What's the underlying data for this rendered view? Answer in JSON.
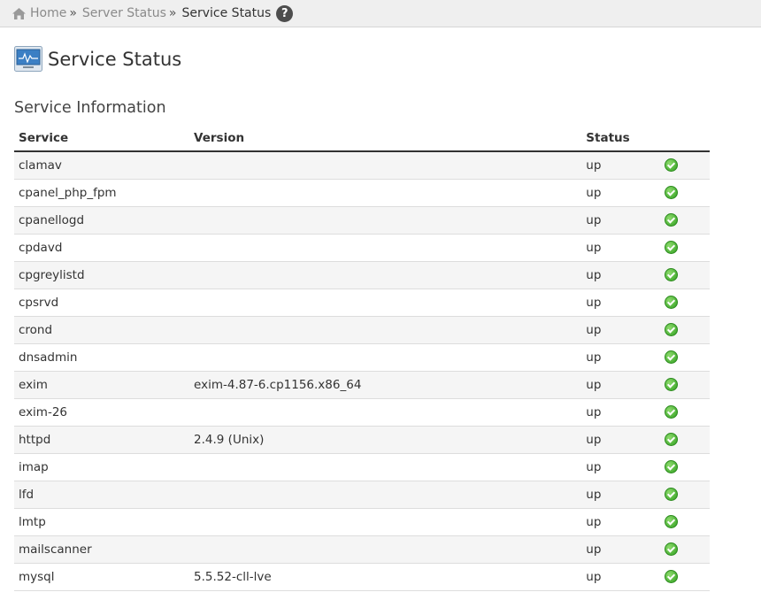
{
  "breadcrumb": {
    "home": "Home",
    "parent": "Server Status",
    "current": "Service Status",
    "separator": "»"
  },
  "page": {
    "title": "Service Status",
    "section_title": "Service Information"
  },
  "table": {
    "headers": {
      "service": "Service",
      "version": "Version",
      "status": "Status"
    },
    "rows": [
      {
        "service": "clamav",
        "version": "",
        "status": "up"
      },
      {
        "service": "cpanel_php_fpm",
        "version": "",
        "status": "up"
      },
      {
        "service": "cpanellogd",
        "version": "",
        "status": "up"
      },
      {
        "service": "cpdavd",
        "version": "",
        "status": "up"
      },
      {
        "service": "cpgreylistd",
        "version": "",
        "status": "up"
      },
      {
        "service": "cpsrvd",
        "version": "",
        "status": "up"
      },
      {
        "service": "crond",
        "version": "",
        "status": "up"
      },
      {
        "service": "dnsadmin",
        "version": "",
        "status": "up"
      },
      {
        "service": "exim",
        "version": "exim-4.87-6.cp1156.x86_64",
        "status": "up"
      },
      {
        "service": "exim-26",
        "version": "",
        "status": "up"
      },
      {
        "service": "httpd",
        "version": "2.4.9 (Unix)",
        "status": "up"
      },
      {
        "service": "imap",
        "version": "",
        "status": "up"
      },
      {
        "service": "lfd",
        "version": "",
        "status": "up"
      },
      {
        "service": "lmtp",
        "version": "",
        "status": "up"
      },
      {
        "service": "mailscanner",
        "version": "",
        "status": "up"
      },
      {
        "service": "mysql",
        "version": "5.5.52-cll-lve",
        "status": "up"
      }
    ]
  },
  "icons": {
    "home": "home-icon",
    "help": "help-icon",
    "page": "monitor-icon",
    "status_ok": "check-circle-icon"
  },
  "colors": {
    "status_ok": "#3aa62a",
    "monitor_screen": "#3b7fc4"
  }
}
